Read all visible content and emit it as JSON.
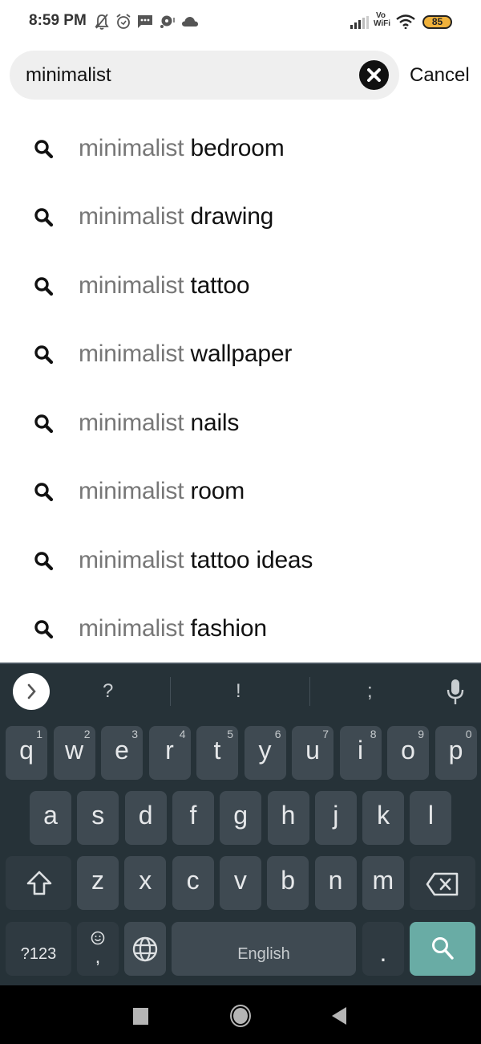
{
  "status_bar": {
    "time": "8:59 PM",
    "left_icons": [
      "notifications-muted-icon",
      "alarm-icon",
      "message-icon",
      "chat-icon",
      "cloud-icon"
    ],
    "right_icons": [
      "signal-icon",
      "vowifi-icon",
      "wifi-icon",
      "battery-icon"
    ],
    "vowifi_label_top": "Vo",
    "vowifi_label_bottom": "WiFi",
    "battery_level": "85",
    "battery_color": "#f0b23c"
  },
  "search": {
    "value": "minimalist",
    "clear_icon": "clear-icon",
    "cancel_label": "Cancel"
  },
  "suggestions": [
    {
      "prefix": "minimalist",
      "suffix": "bedroom"
    },
    {
      "prefix": "minimalist",
      "suffix": "drawing"
    },
    {
      "prefix": "minimalist",
      "suffix": "tattoo"
    },
    {
      "prefix": "minimalist",
      "suffix": "wallpaper"
    },
    {
      "prefix": "minimalist",
      "suffix": "nails"
    },
    {
      "prefix": "minimalist",
      "suffix": "room"
    },
    {
      "prefix": "minimalist",
      "suffix": "tattoo ideas"
    },
    {
      "prefix": "minimalist",
      "suffix": "fashion"
    }
  ],
  "keyboard": {
    "toolbar": {
      "symbols": [
        "?",
        "!",
        ";"
      ]
    },
    "row1": [
      {
        "key": "q",
        "hint": "1"
      },
      {
        "key": "w",
        "hint": "2"
      },
      {
        "key": "e",
        "hint": "3"
      },
      {
        "key": "r",
        "hint": "4"
      },
      {
        "key": "t",
        "hint": "5"
      },
      {
        "key": "y",
        "hint": "6"
      },
      {
        "key": "u",
        "hint": "7"
      },
      {
        "key": "i",
        "hint": "8"
      },
      {
        "key": "o",
        "hint": "9"
      },
      {
        "key": "p",
        "hint": "0"
      }
    ],
    "row2": [
      "a",
      "s",
      "d",
      "f",
      "g",
      "h",
      "j",
      "k",
      "l"
    ],
    "row3": [
      "z",
      "x",
      "c",
      "v",
      "b",
      "n",
      "m"
    ],
    "row4": {
      "symbols_label": "?123",
      "comma_label": ",",
      "space_label": "English",
      "period_label": "."
    },
    "accent_color": "#69aca5",
    "background_color": "#263238"
  },
  "nav_bar": {
    "buttons": [
      "recents-button",
      "home-button",
      "back-button"
    ]
  }
}
